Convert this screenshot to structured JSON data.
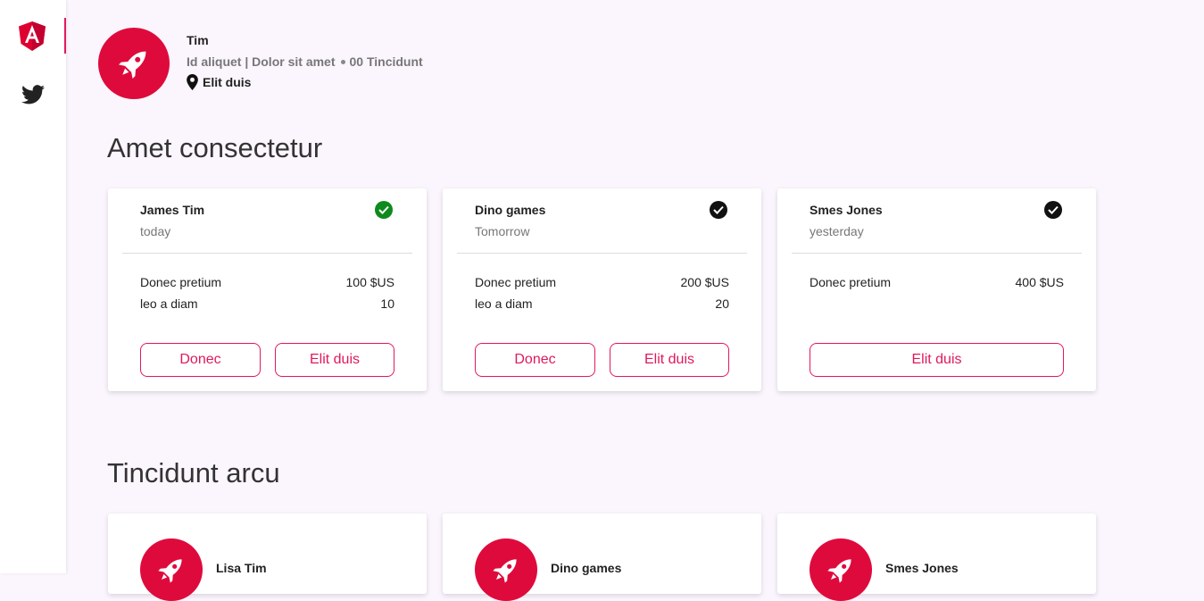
{
  "sidebar": {
    "items": [
      {
        "icon": "angular-icon",
        "active": true
      },
      {
        "icon": "twitter-icon",
        "active": false
      }
    ]
  },
  "profile": {
    "name": "Tim",
    "meta_left": "Id aliquet | Dolor sit amet",
    "meta_right": "00 Tincidunt",
    "location": "Elit duis"
  },
  "section1": {
    "title": "Amet consectetur",
    "cards": [
      {
        "name": "James Tim",
        "date": "today",
        "check_color": "#0f8a1e",
        "lines": [
          {
            "label": "Donec pretium",
            "value": "100 $US"
          },
          {
            "label": "leo a diam",
            "value": "10"
          }
        ],
        "buttons": [
          "Donec",
          "Elit duis"
        ]
      },
      {
        "name": "Dino games",
        "date": "Tomorrow",
        "check_color": "#111111",
        "lines": [
          {
            "label": "Donec pretium",
            "value": "200 $US"
          },
          {
            "label": "leo a diam",
            "value": "20"
          }
        ],
        "buttons": [
          "Donec",
          "Elit duis"
        ]
      },
      {
        "name": "Smes Jones",
        "date": "yesterday",
        "check_color": "#111111",
        "lines": [
          {
            "label": "Donec pretium",
            "value": "400 $US"
          }
        ],
        "buttons": [
          "Elit duis"
        ]
      }
    ]
  },
  "section2": {
    "title": "Tincidunt arcu",
    "cards": [
      {
        "name": "Lisa Tim"
      },
      {
        "name": "Dino games"
      },
      {
        "name": "Smes Jones"
      }
    ]
  },
  "colors": {
    "accent": "#e0195c",
    "avatar": "#df0a3c",
    "background": "#fbf5fd"
  }
}
